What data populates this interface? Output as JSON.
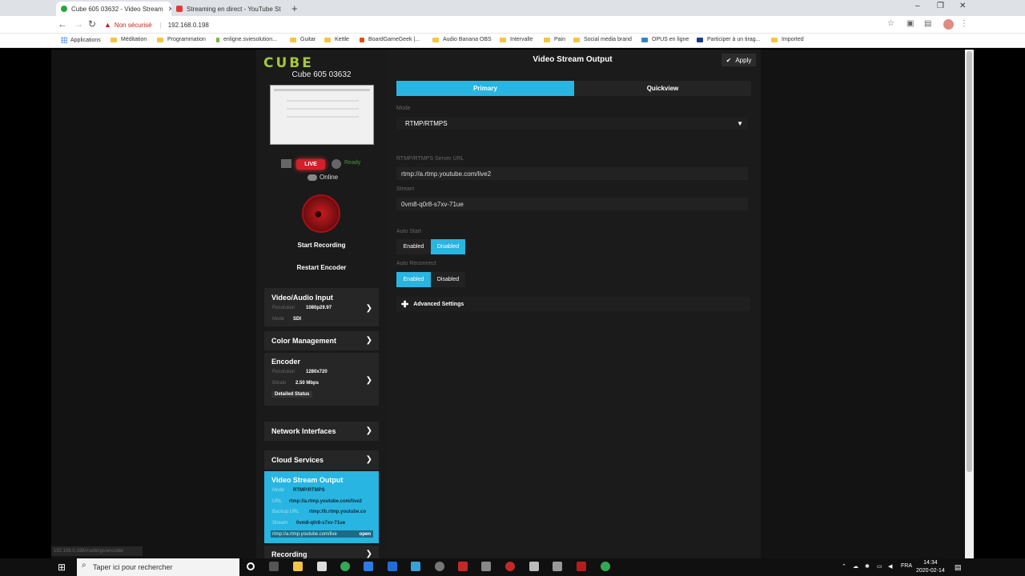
{
  "browser": {
    "tabs": [
      {
        "title": "Cube 605 03632 - Video Stream",
        "color": "#2ea043"
      },
      {
        "title": "Streaming en direct - YouTube St",
        "color": "#e53935"
      }
    ],
    "url": "192.168.0.198",
    "security_label": "Non sécurisé",
    "bookmarks": [
      "Applications",
      "Méditation",
      "Programmation",
      "enligne.sviesolution...",
      "Guitar",
      "Kettle",
      "BoardGameGeek |...",
      "Audio Banana OBS",
      "Intervalle",
      "Pain",
      "Social media brand",
      "OPUS en ligne",
      "Participer à un tirag...",
      "Imported"
    ]
  },
  "sidebar": {
    "logo": "CUBE",
    "device_name": "Cube 605 03632",
    "live_label": "LIVE",
    "ready_label": "Ready",
    "online_label": "Online",
    "start_recording": "Start Recording",
    "restart_encoder": "Restart Encoder",
    "video_input": {
      "title": "Video/Audio Input",
      "resolution_label": "Resolution",
      "resolution": "1080p29.97",
      "mode_label": "Mode",
      "mode": "SDI"
    },
    "color_mgmt": {
      "title": "Color Management"
    },
    "encoder": {
      "title": "Encoder",
      "resolution_label": "Resolution",
      "resolution": "1280x720",
      "bitrate_label": "Bitrate",
      "bitrate": "2.50 Mbps",
      "detailed": "Detailed Status"
    },
    "network": {
      "title": "Network Interfaces"
    },
    "cloud": {
      "title": "Cloud Services"
    },
    "vso": {
      "title": "Video Stream Output",
      "mode_label": "Mode",
      "mode": "RTMP/RTMPS",
      "url_label": "URL",
      "url": "rtmp://a.rtmp.youtube.com/live2",
      "backup_label": "Backup URL",
      "backup": "rtmp://b.rtmp.youtube.co",
      "stream_label": "Stream",
      "stream": "0vm8-q0r8-s7xv-71ue",
      "open_url": "rtmp://a.rtmp.youtube.com/live",
      "open_label": "open"
    },
    "recording": {
      "title": "Recording"
    },
    "status_link": "192.168.0.198/#settings/encoder"
  },
  "main": {
    "title": "Video Stream Output",
    "apply": "Apply",
    "tab_primary": "Primary",
    "tab_quickview": "Quickview",
    "mode_label": "Mode",
    "mode_value": "RTMP/RTMPS",
    "server_label": "RTMP/RTMPS Server URL",
    "server_value": "rtmp://a.rtmp.youtube.com/live2",
    "stream_label": "Stream",
    "stream_value": "0vm8-q0r8-s7xv-71ue",
    "autostart_label": "Auto Start",
    "autoreconnect_label": "Auto Reconnect",
    "enabled": "Enabled",
    "disabled": "Disabled",
    "advanced": "Advanced Settings"
  },
  "taskbar": {
    "search_placeholder": "Taper ici pour rechercher",
    "lang": "FRA",
    "time": "14:34",
    "date": "2020-02-14"
  },
  "colors": {
    "accent": "#28b5e1",
    "live": "#d21f2a",
    "logo": "#a7c63a"
  }
}
